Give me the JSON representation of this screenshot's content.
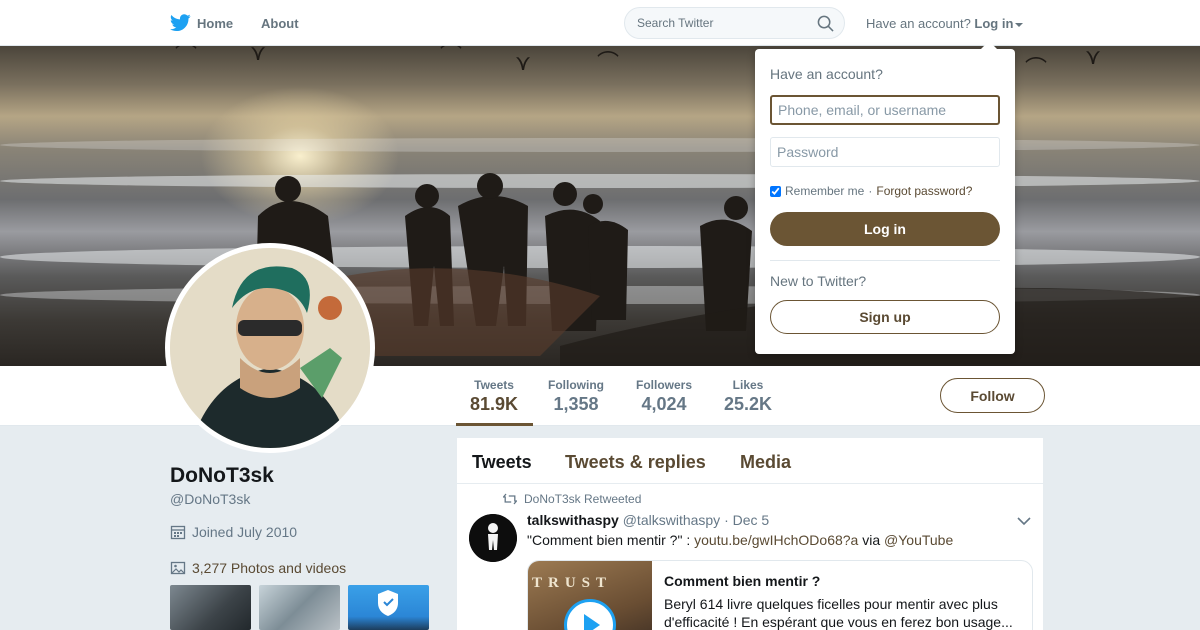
{
  "nav": {
    "home_label": "Home",
    "about_label": "About",
    "search_placeholder": "Search Twitter",
    "have_account_text": "Have an account?",
    "login_label": "Log in"
  },
  "profile": {
    "name": "DoNoT3sk",
    "handle": "@DoNoT3sk",
    "joined": "Joined July 2010",
    "photos_label": "3,277 Photos and videos",
    "follow_label": "Follow"
  },
  "stats": [
    {
      "label": "Tweets",
      "value": "81.9K"
    },
    {
      "label": "Following",
      "value": "1,358"
    },
    {
      "label": "Followers",
      "value": "4,024"
    },
    {
      "label": "Likes",
      "value": "25.2K"
    }
  ],
  "timeline": {
    "tabs": [
      "Tweets",
      "Tweets & replies",
      "Media"
    ],
    "tweet": {
      "retweet_note": "DoNoT3sk Retweeted",
      "author_name": "talkswithaspy",
      "author_handle": "@talkswithaspy",
      "date": "· Dec 5",
      "text_prefix": "\"Comment bien mentir ?\" :",
      "link": "youtu.be/gwIHchODo68?a",
      "via": "via",
      "mention": "@YouTube",
      "card_title": "Comment bien mentir ?",
      "card_desc": "Beryl 614 livre quelques ficelles pour mentir avec plus d'efficacité ! En espérant que vous en ferez bon usage...",
      "card_image_text": "TRUST"
    }
  },
  "login_dropdown": {
    "title": "Have an account?",
    "username_placeholder": "Phone, email, or username",
    "password_placeholder": "Password",
    "remember_label": "Remember me",
    "separator": "·",
    "forgot_label": "Forgot password?",
    "login_button": "Log in",
    "new_to_twitter": "New to Twitter?",
    "signup_button": "Sign up"
  },
  "colors": {
    "accent": "#6b5534",
    "twitter_blue": "#1da1f2"
  }
}
